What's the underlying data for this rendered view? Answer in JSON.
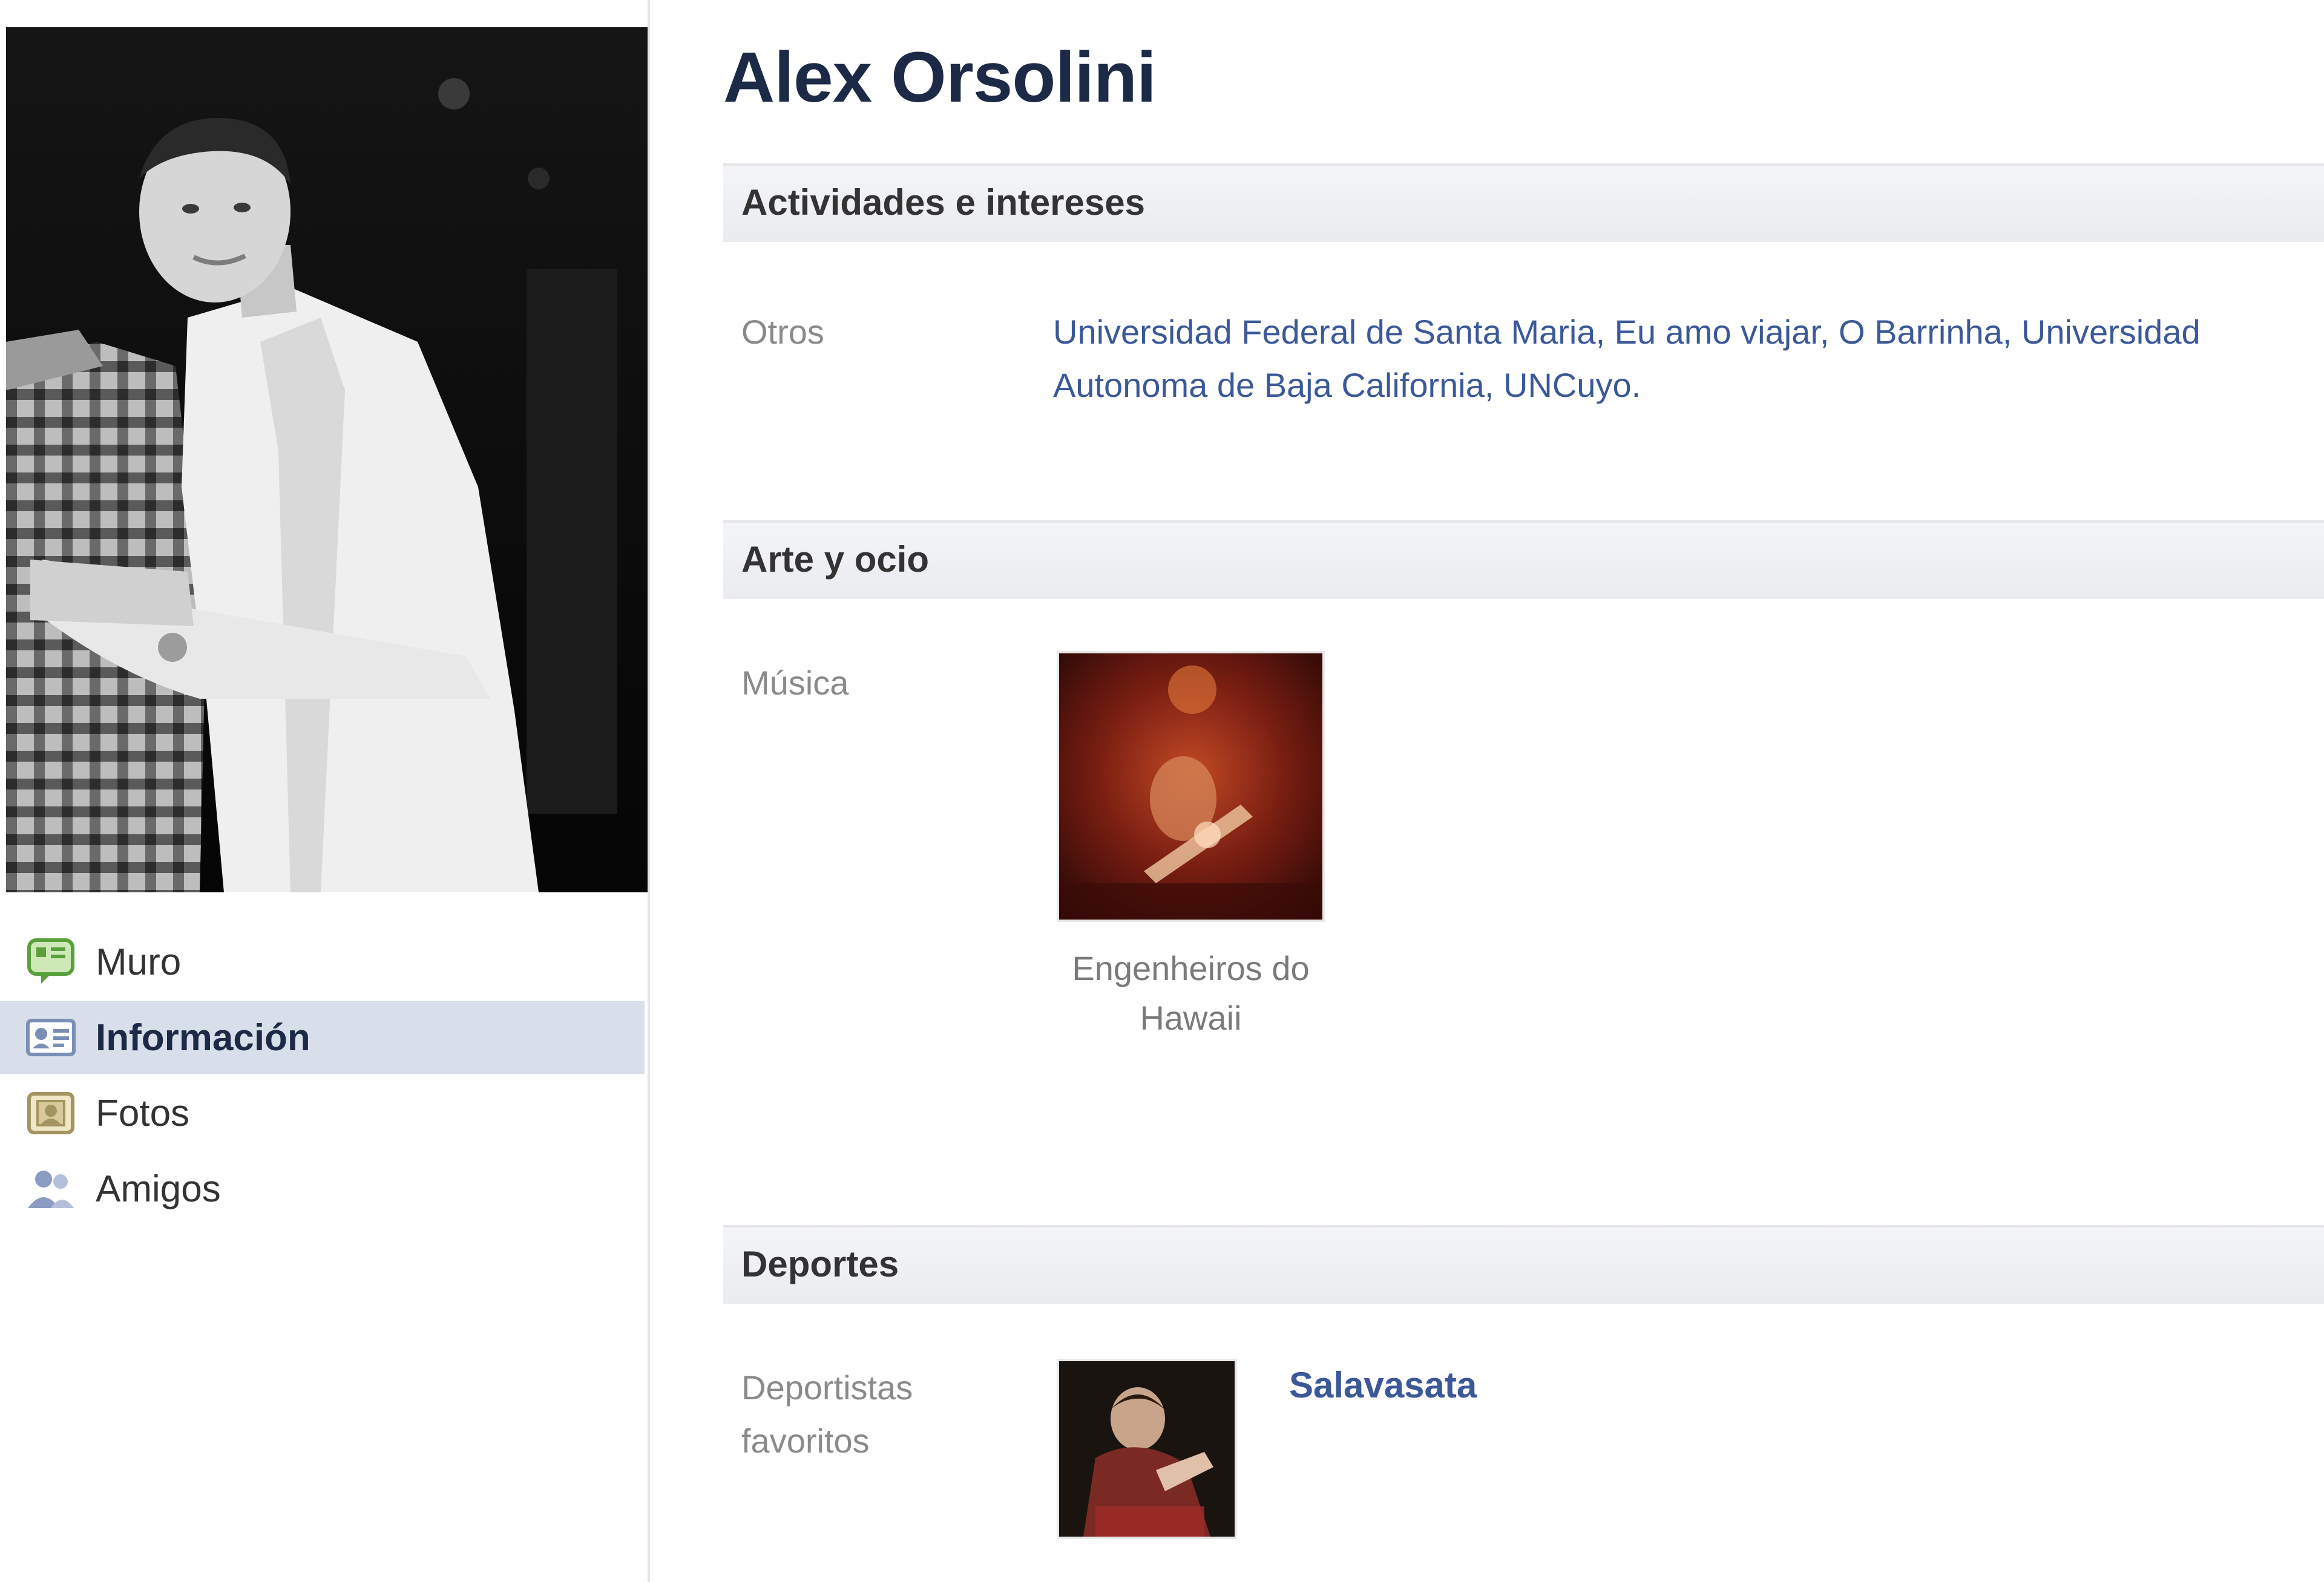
{
  "profile": {
    "name": "Alex Orsolini"
  },
  "nav": {
    "items": [
      {
        "label": "Muro",
        "icon": "wall-icon",
        "selected": false
      },
      {
        "label": "Información",
        "icon": "info-card-icon",
        "selected": true
      },
      {
        "label": "Fotos",
        "icon": "photos-icon",
        "selected": false
      },
      {
        "label": "Amigos",
        "icon": "friends-icon",
        "selected": false
      }
    ]
  },
  "sections": {
    "activities": {
      "title": "Actividades e intereses",
      "other_label": "Otros",
      "other_links": [
        "Universidad Federal de Santa Maria",
        "Eu amo viajar",
        "O Barrinha",
        "Universidad Autonoma de Baja California",
        "UNCuyo"
      ],
      "separator": ", ",
      "trailing": "."
    },
    "arts": {
      "title": "Arte y ocio",
      "music_label": "Música",
      "music_items": [
        {
          "caption": "Engenheiros do Hawaii",
          "image": "band-thumbnail"
        }
      ]
    },
    "sports": {
      "title": "Deportes",
      "athletes_label": "Deportistas favoritos",
      "athletes": [
        {
          "name": "Salavasata",
          "image": "athlete-thumbnail"
        }
      ]
    }
  },
  "colors": {
    "link": "#3b5998",
    "name": "#1c2a47",
    "nav_selected_bg": "#d8dfea",
    "label_gray": "#8a8a8a"
  }
}
